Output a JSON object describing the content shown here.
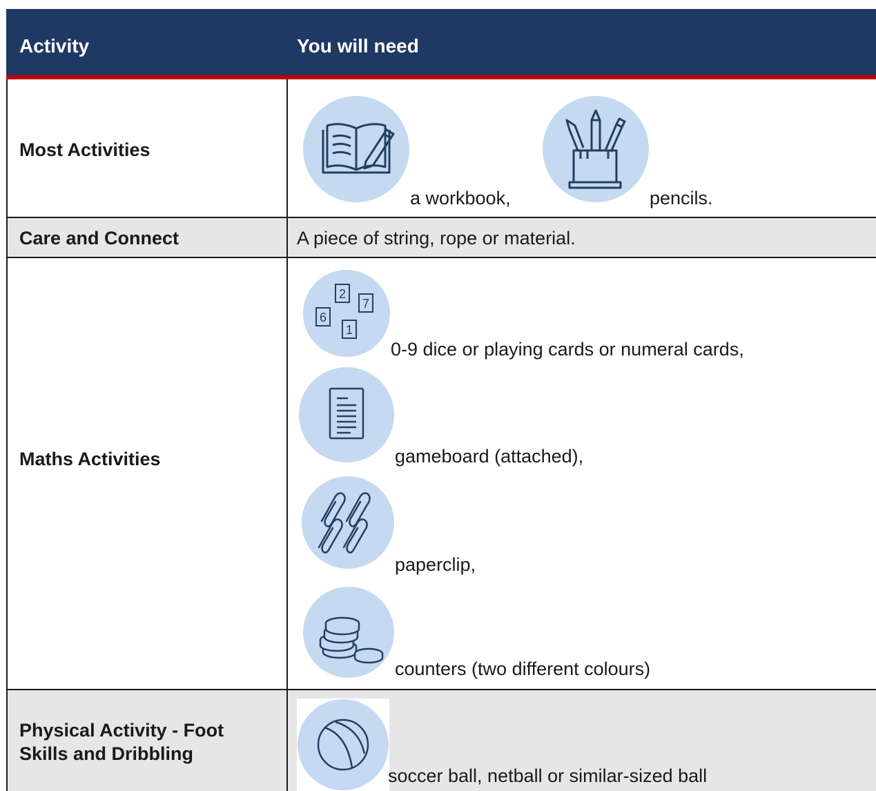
{
  "header": {
    "col1": "Activity",
    "col2": "You will need"
  },
  "rows": [
    {
      "label": "Most Activities",
      "items": [
        {
          "icon": "workbook-icon",
          "text": "a workbook,"
        },
        {
          "icon": "pencils-icon",
          "text": "pencils."
        }
      ]
    },
    {
      "label": "Care and Connect",
      "text": "A piece of string, rope or material."
    },
    {
      "label": "Maths Activities",
      "items": [
        {
          "icon": "number-cards-icon",
          "text": "0-9 dice or playing cards or numeral cards,"
        },
        {
          "icon": "document-icon",
          "text": "gameboard (attached),"
        },
        {
          "icon": "paperclip-icon",
          "text": "paperclip,"
        },
        {
          "icon": "counters-icon",
          "text": "counters (two different colours)"
        }
      ],
      "cards": [
        "2",
        "7",
        "6",
        "1"
      ]
    },
    {
      "label_line1": "Physical Activity - Foot",
      "label_line2": "Skills and Dribbling",
      "items": [
        {
          "icon": "ball-icon",
          "text": "soccer ball, netball or similar-sized ball"
        }
      ]
    }
  ],
  "colors": {
    "header_bg": "#203864",
    "header_rule": "#c00000",
    "row_grey": "#e7e6e6",
    "icon_circle": "#c5d9f1",
    "icon_stroke": "#243f60"
  }
}
